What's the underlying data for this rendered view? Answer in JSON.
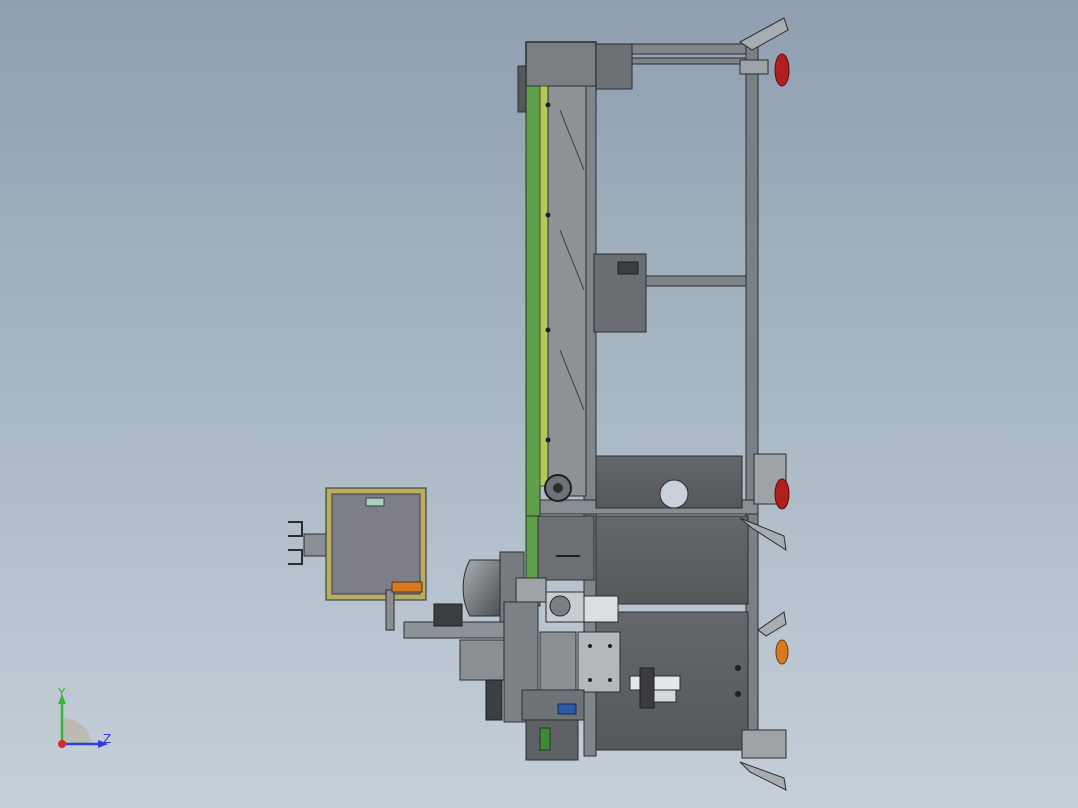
{
  "viewport": {
    "background_top": "#8f9fb1",
    "background_bottom": "#c5cfd9"
  },
  "model": {
    "frame_color": "#6d7378",
    "panel_color": "#5a5e61",
    "conveyor_color": "#5f9e4a",
    "conveyor_highlight": "#b7c85a",
    "foot_accent_color": "#b01f1f",
    "foot_orange_color": "#d77a1f",
    "box_color": "#7e7e88",
    "box_frame_color": "#b7ac62"
  },
  "triad": {
    "y_label": "Y",
    "z_label": "Z",
    "y_color": "#3ab53a",
    "z_color": "#2f3fd6",
    "x_color": "#d42a2a"
  }
}
